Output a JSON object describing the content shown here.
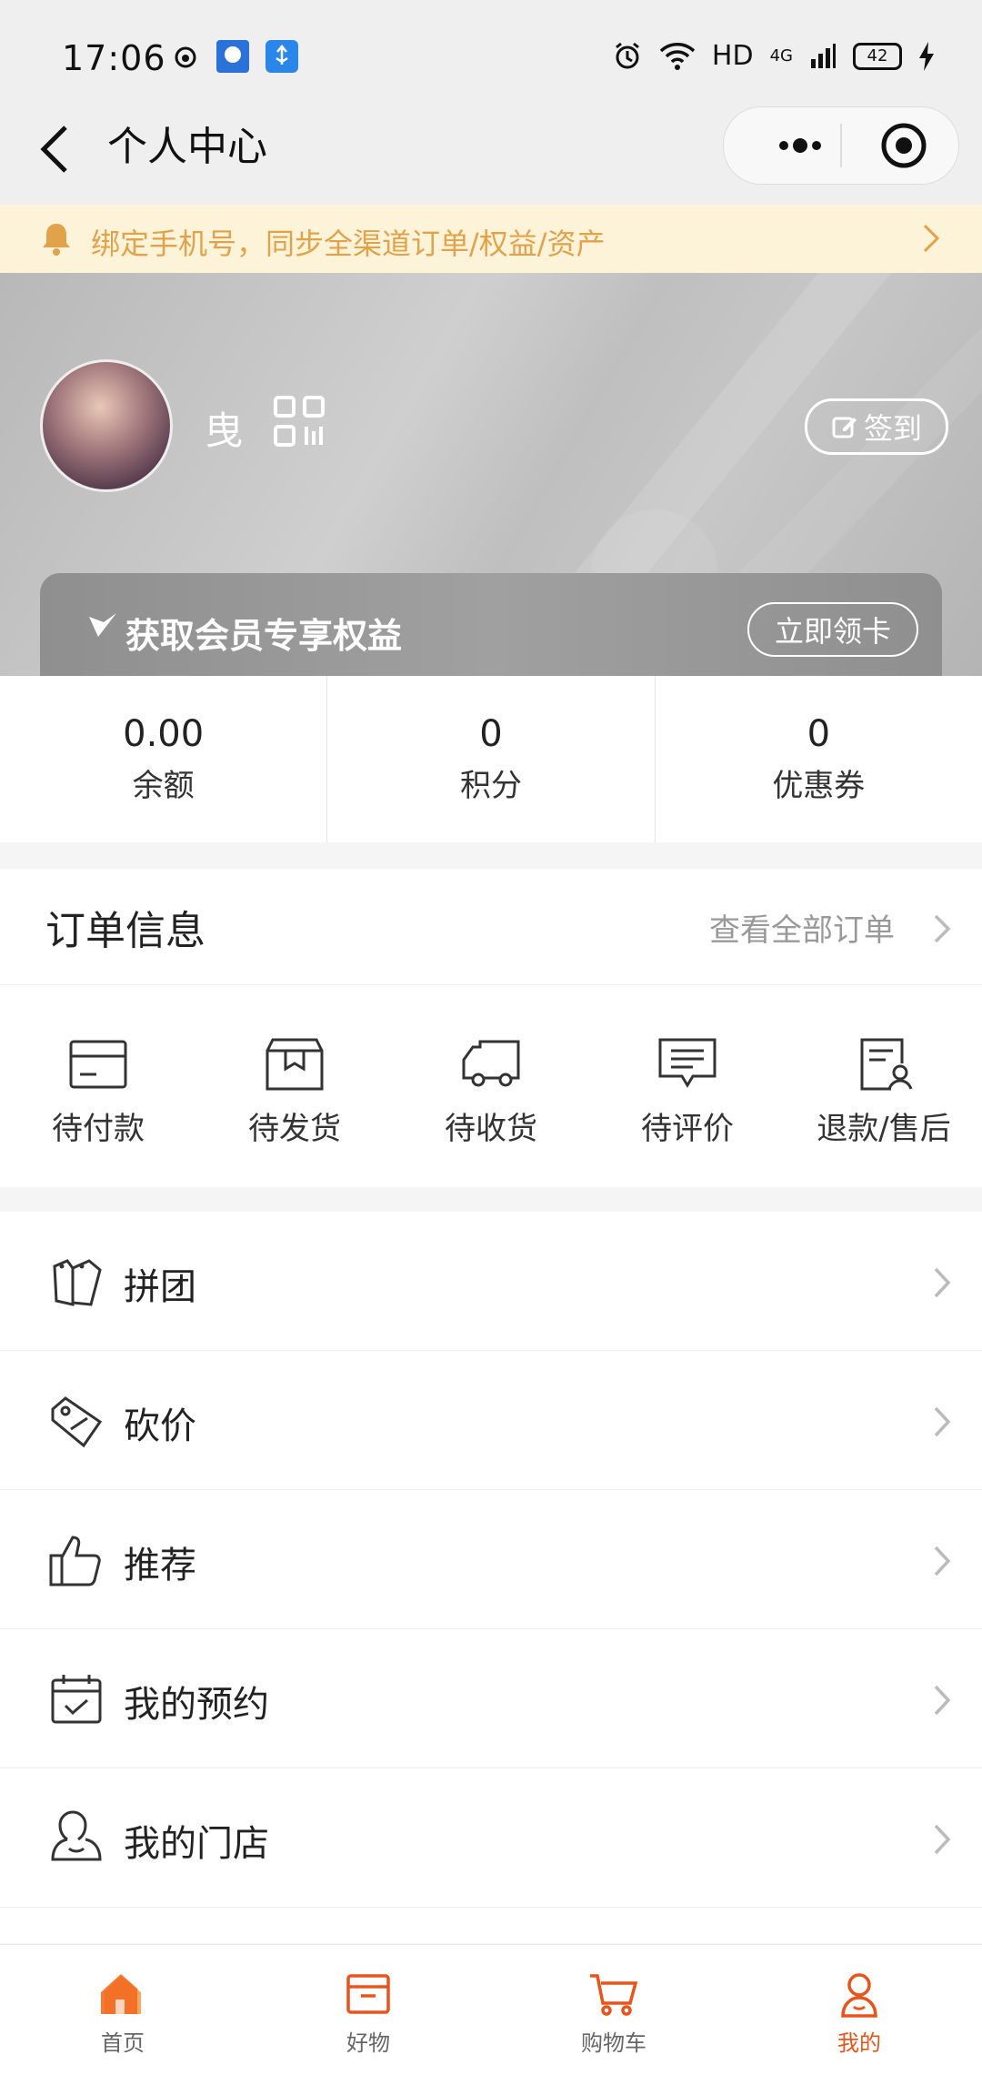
{
  "status_bar": {
    "time": "17:06",
    "network": "HD",
    "signal": "4G",
    "battery": "42"
  },
  "nav": {
    "title": "个人中心"
  },
  "bind_banner": {
    "text": "绑定手机号，同步全渠道订单/权益/资产"
  },
  "profile": {
    "username": "曳",
    "signin_label": "签到"
  },
  "member_card": {
    "text": "获取会员专享权益",
    "button": "立即领卡"
  },
  "stats": [
    {
      "value": "0.00",
      "label": "余额"
    },
    {
      "value": "0",
      "label": "积分"
    },
    {
      "value": "0",
      "label": "优惠券"
    }
  ],
  "orders": {
    "title": "订单信息",
    "view_all": "查看全部订单",
    "items": [
      {
        "label": "待付款",
        "icon": "card-icon"
      },
      {
        "label": "待发货",
        "icon": "box-icon"
      },
      {
        "label": "待收货",
        "icon": "truck-icon"
      },
      {
        "label": "待评价",
        "icon": "comment-icon"
      },
      {
        "label": "退款/售后",
        "icon": "refund-icon"
      }
    ]
  },
  "menu": [
    {
      "label": "拼团",
      "icon": "tags-icon"
    },
    {
      "label": "砍价",
      "icon": "price-tag-icon"
    },
    {
      "label": "推荐",
      "icon": "thumbs-up-icon"
    },
    {
      "label": "我的预约",
      "icon": "calendar-check-icon"
    },
    {
      "label": "我的门店",
      "icon": "user-icon"
    }
  ],
  "tabbar": [
    {
      "label": "首页",
      "icon": "home-icon"
    },
    {
      "label": "好物",
      "icon": "box-icon"
    },
    {
      "label": "购物车",
      "icon": "cart-icon"
    },
    {
      "label": "我的",
      "icon": "profile-icon",
      "active": true
    }
  ],
  "colors": {
    "accent": "#e8541c",
    "banner_text": "#e1a24a",
    "banner_bg": "#fdf3d9"
  }
}
